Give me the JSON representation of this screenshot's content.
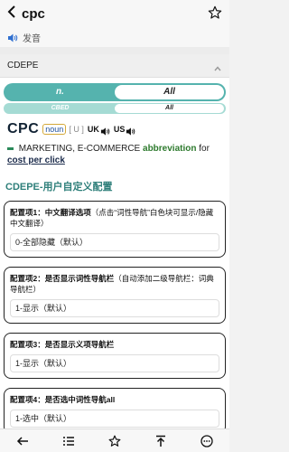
{
  "topbar": {
    "word": "cpc"
  },
  "pron": {
    "label": "发音"
  },
  "dict": {
    "name": "CDEPE"
  },
  "tabs": {
    "top": [
      "n.",
      "All"
    ],
    "sub": [
      "CBED",
      "All"
    ]
  },
  "entry": {
    "headword": "CPC",
    "pos": "noun",
    "ipa": "[ U ]",
    "uk": "UK",
    "us": "US",
    "domain": "MARKETING, E-COMMERCE",
    "gram": "abbreviation",
    "for_label": "for",
    "definition": "cost per click"
  },
  "config": {
    "title": "CDEPE-用户自定义配置",
    "items": [
      {
        "label": "配置项1：",
        "name": "中文翻译选项",
        "note": "（点击“词性导航”白色块可显示/隐藏中文翻译）",
        "value": "0-全部隐藏（默认）"
      },
      {
        "label": "配置项2：",
        "name": "是否显示词性导航栏",
        "note": "（自动添加二级导航栏：词典导航栏）",
        "value": "1-显示（默认）"
      },
      {
        "label": "配置项3：",
        "name": "是否显示义项导航栏",
        "note": "",
        "value": "1-显示（默认）"
      },
      {
        "label": "配置项4：",
        "name": "是否选中词性导航all",
        "note": "",
        "value": "1-选中（默认）"
      }
    ]
  },
  "colors": {
    "accent": "#55b3ae",
    "accent_light": "#a5dbd4",
    "title": "#2e7f7a"
  }
}
